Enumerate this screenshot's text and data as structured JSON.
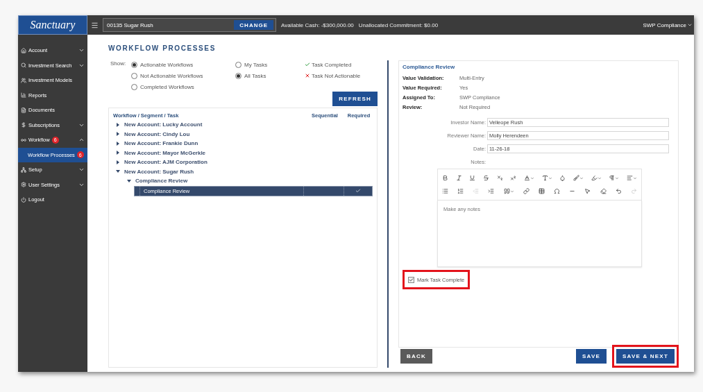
{
  "logo": {
    "text": "Sanctuary"
  },
  "account": {
    "value": "00135 Sugar Rush",
    "button": "CHANGE"
  },
  "balances": [
    "Available Cash: -$300,000.00",
    "Unallocated Commitment: $0.00"
  ],
  "user_menu": {
    "label": "SWP Compliance"
  },
  "sidebar": {
    "items": [
      {
        "label": "Account",
        "expanded": false
      },
      {
        "label": "Investment Search",
        "expanded": false
      },
      {
        "label": "Investment Models"
      },
      {
        "label": "Reports"
      },
      {
        "label": "Documents"
      },
      {
        "label": "Subscriptions",
        "expanded": false
      },
      {
        "label": "Workflow",
        "badge": "6",
        "expanded": true,
        "children": [
          {
            "label": "Workflow Processes",
            "badge": "6",
            "selected": true
          }
        ]
      },
      {
        "label": "Setup",
        "expanded": false
      },
      {
        "label": "User Settings",
        "expanded": false
      },
      {
        "label": "Logout"
      }
    ]
  },
  "page_title": "WORKFLOW PROCESSES",
  "filters": {
    "label": "Show:",
    "workflow_options": [
      {
        "label": "Actionable Workflows",
        "selected": true
      },
      {
        "label": "Not Actionable Workflows",
        "selected": false
      },
      {
        "label": "Completed Workflows",
        "selected": false
      }
    ],
    "task_options": [
      {
        "label": "My Tasks",
        "selected": false
      },
      {
        "label": "All Tasks",
        "selected": true
      }
    ],
    "legend": [
      {
        "kind": "completed",
        "label": "Task Completed"
      },
      {
        "kind": "not_actionable",
        "label": "Task Not Actionable"
      }
    ]
  },
  "refresh_button": "REFRESH",
  "table": {
    "columns": [
      "Workflow / Segment / Task",
      "Sequential",
      "Required"
    ],
    "rows": [
      {
        "label": "New Account: Lucky Account",
        "expanded": false
      },
      {
        "label": "New Account: Cindy Lou",
        "expanded": false
      },
      {
        "label": "New Account: Frankie Dunn",
        "expanded": false
      },
      {
        "label": "New Account: Mayor McGerkle",
        "expanded": false
      },
      {
        "label": "New Account: AJM Corporation",
        "expanded": false
      },
      {
        "label": "New Account: Sugar Rush",
        "expanded": true,
        "children": [
          {
            "label": "Compliance Review",
            "expanded": true,
            "children": [
              {
                "label": "Compliance Review",
                "sequential": false,
                "required": true,
                "selected": true
              }
            ]
          }
        ]
      }
    ]
  },
  "detail": {
    "title": "Compliance Review",
    "properties": [
      {
        "label": "Value Validation:",
        "value": "Multi-Entry"
      },
      {
        "label": "Value Required:",
        "value": "Yes"
      },
      {
        "label": "Assigned To:",
        "value": "SWP Compliance"
      },
      {
        "label": "Review:",
        "value": "Not Required"
      }
    ],
    "fields": [
      {
        "label": "Investor Name:",
        "value": "Velleope Rush"
      },
      {
        "label": "Reviewer Name:",
        "value": "Molly Herendeen"
      },
      {
        "label": "Date:",
        "value": "11-26-18"
      }
    ],
    "notes_label": "Notes:",
    "toolbar": [
      [
        {
          "kind": "bold"
        },
        {
          "kind": "italic"
        },
        {
          "kind": "underline"
        },
        {
          "kind": "strike"
        },
        {
          "kind": "subscript"
        },
        {
          "kind": "superscript"
        },
        {
          "kind": "font-color",
          "menu": true
        },
        {
          "kind": "font-size",
          "menu": true
        },
        {
          "kind": "drop"
        },
        {
          "kind": "brush",
          "menu": true
        },
        {
          "kind": "highlighter",
          "menu": true
        },
        {
          "kind": "paragraph",
          "menu": true
        },
        {
          "kind": "align",
          "menu": true
        }
      ],
      [
        {
          "kind": "list"
        },
        {
          "kind": "ordered-list"
        },
        {
          "kind": "outdent",
          "disabled": true
        },
        {
          "kind": "indent"
        },
        {
          "kind": "quote",
          "menu": true
        },
        {
          "kind": "link"
        },
        {
          "kind": "table"
        },
        {
          "kind": "omega"
        },
        {
          "kind": "rule"
        },
        {
          "kind": "pointer"
        },
        {
          "kind": "eraser"
        },
        {
          "kind": "undo"
        },
        {
          "kind": "redo",
          "disabled": true
        }
      ]
    ],
    "notes_placeholder": "Make any notes",
    "mark_complete": {
      "label": "Mark Task Complete",
      "checked": true,
      "highlighted": true
    }
  },
  "buttons": [
    {
      "kind": "back",
      "label": "BACK",
      "highlighted": false
    },
    {
      "kind": "save",
      "label": "SAVE",
      "highlighted": false
    },
    {
      "kind": "save_next",
      "label": "SAVE & NEXT",
      "highlighted": true
    }
  ]
}
